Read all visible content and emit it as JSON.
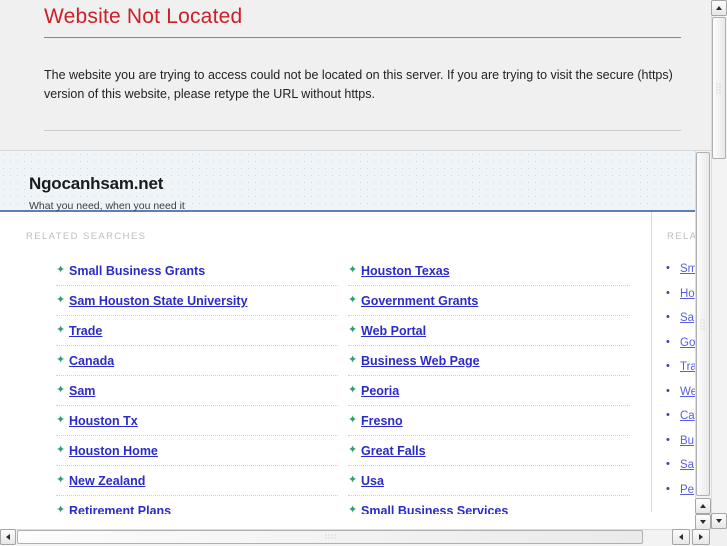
{
  "error_page": {
    "title": "Website Not Located",
    "body": "The website you are trying to access could not be located on this server. If you are trying to visit the secure (https) version of this website, please retype the URL without https."
  },
  "parked_page": {
    "brand_name": "Ngocanhsam.net",
    "tagline": "What you need, when you need it",
    "section_label": "RELATED SEARCHES",
    "side_section_label": "RELATED",
    "bullet_icon": "star-bullet-icon",
    "side_bullet_icon": "round-bullet-icon",
    "link_color": "#2b2bcc",
    "bullet_color": "#2f9e6e",
    "header_band_color": "#eef4f8",
    "header_rule_color": "#5b7fba",
    "columns": [
      {
        "name": "column-left",
        "links": [
          {
            "label": "Small Business Grants",
            "underlined": false
          },
          {
            "label": "Sam Houston State University",
            "underlined": true
          },
          {
            "label": "Trade",
            "underlined": true
          },
          {
            "label": "Canada",
            "underlined": true
          },
          {
            "label": "Sam",
            "underlined": true
          },
          {
            "label": "Houston Tx",
            "underlined": true
          },
          {
            "label": "Houston Home",
            "underlined": true
          },
          {
            "label": "New Zealand",
            "underlined": true
          },
          {
            "label": "Retirement Plans",
            "underlined": true
          }
        ]
      },
      {
        "name": "column-middle",
        "links": [
          {
            "label": "Houston Texas",
            "underlined": true
          },
          {
            "label": "Government Grants",
            "underlined": true
          },
          {
            "label": "Web Portal",
            "underlined": true
          },
          {
            "label": "Business Web Page",
            "underlined": true
          },
          {
            "label": "Peoria",
            "underlined": true
          },
          {
            "label": "Fresno",
            "underlined": true
          },
          {
            "label": "Great Falls",
            "underlined": true
          },
          {
            "label": "Usa",
            "underlined": true
          },
          {
            "label": "Small Business Services",
            "underlined": true
          }
        ]
      }
    ],
    "side_links": [
      {
        "label": "Sm"
      },
      {
        "label": "Ho"
      },
      {
        "label": "Sa"
      },
      {
        "label": "Go"
      },
      {
        "label": "Tra"
      },
      {
        "label": "We"
      },
      {
        "label": "Ca"
      },
      {
        "label": "Bu"
      },
      {
        "label": "Sa"
      },
      {
        "label": "Pe"
      }
    ]
  },
  "scrollbars": {
    "up_arrow": "scroll-up-arrow-icon",
    "down_arrow": "scroll-down-arrow-icon",
    "left_arrow": "scroll-left-arrow-icon",
    "right_arrow": "scroll-right-arrow-icon"
  }
}
